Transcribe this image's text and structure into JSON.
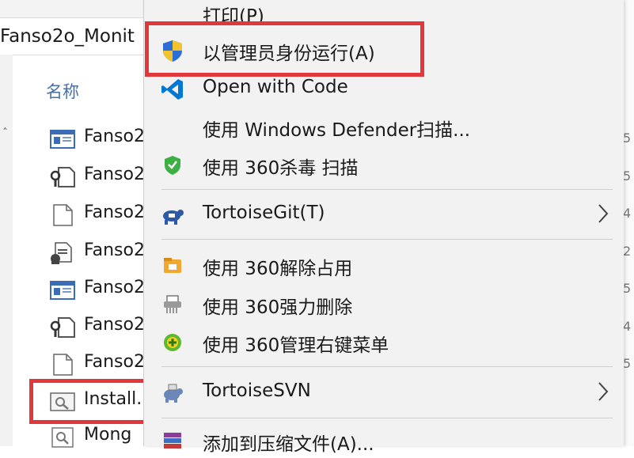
{
  "explorer": {
    "path": "Fanso2o_Monit",
    "column_name_label": "名称",
    "files": [
      {
        "name": "Fanso2",
        "icon": "application-window-icon"
      },
      {
        "name": "Fanso2",
        "icon": "config-file-icon"
      },
      {
        "name": "Fanso2",
        "icon": "blank-file-icon"
      },
      {
        "name": "Fanso2",
        "icon": "script-file-icon"
      },
      {
        "name": "Fanso2",
        "icon": "application-window-icon"
      },
      {
        "name": "Fanso2",
        "icon": "config-file-icon"
      },
      {
        "name": "Fanso2",
        "icon": "blank-file-icon"
      },
      {
        "name": "Install.",
        "icon": "batch-file-icon"
      },
      {
        "name": "Mong",
        "icon": "batch-file-icon"
      }
    ],
    "edge_chars": [
      "5",
      "5",
      "4",
      "2",
      "5",
      "4",
      "5"
    ]
  },
  "menu": {
    "print": "打印(P)",
    "run_as_admin": "以管理员身份运行(A)",
    "open_with_code": "Open with Code",
    "defender_scan": "使用 Windows Defender扫描...",
    "scan_360": "使用 360杀毒 扫描",
    "tortoisegit": "TortoiseGit(T)",
    "unlock_360": "使用 360解除占用",
    "force_delete_360": "使用 360强力删除",
    "manage_menu_360": "使用 360管理右键菜单",
    "tortoisesvn": "TortoiseSVN",
    "add_to_archive": "添加到压缩文件(A)..."
  },
  "colors": {
    "highlight_border": "#e0383b",
    "menu_background": "#f2f2f2",
    "column_header": "#4a6fa5",
    "vscode_blue": "#0078d4"
  }
}
